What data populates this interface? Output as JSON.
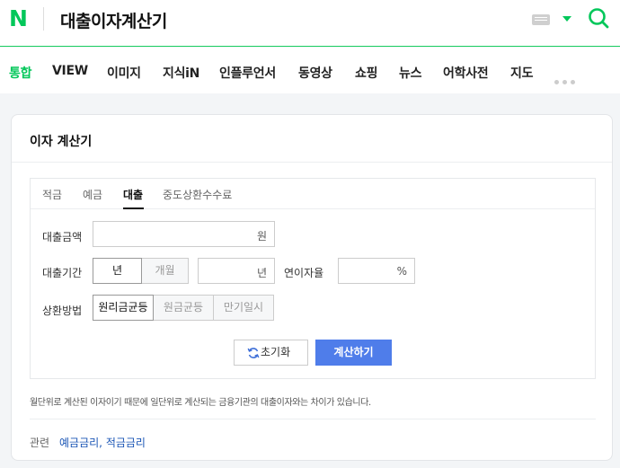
{
  "header": {
    "logo": "N",
    "query": "대출이자계산기",
    "keyboard_icon": "keyboard-icon",
    "search_icon": "search-icon",
    "accent": "#03c75a"
  },
  "nav": {
    "items": [
      "통합",
      "VIEW",
      "이미지",
      "지식iN",
      "인플루언서",
      "동영상",
      "쇼핑",
      "뉴스",
      "어학사전",
      "지도"
    ],
    "active_index": 0
  },
  "calculator": {
    "title": "이자 계산기",
    "tabs": [
      "적금",
      "예금",
      "대출",
      "중도상환수수료"
    ],
    "active_tab": "대출",
    "loan_amount": {
      "label": "대출금액",
      "value": "",
      "unit": "원"
    },
    "loan_term": {
      "label": "대출기간",
      "options": [
        "년",
        "개월"
      ],
      "selected": "년",
      "value": "",
      "unit": "년"
    },
    "rate": {
      "label": "연이자율",
      "value": "",
      "unit": "%"
    },
    "repayment": {
      "label": "상환방법",
      "options": [
        "원리금균등",
        "원금균등",
        "만기일시"
      ],
      "selected": "원리금균등"
    },
    "reset_label": "초기화",
    "calc_label": "계산하기",
    "primary_color": "#4f7dea"
  },
  "notice": "월단위로 계산된 이자이기 때문에 일단위로 계산되는 금융기관의 대출이자와는 차이가 있습니다.",
  "related": {
    "label": "관련",
    "links": [
      "예금금리",
      "적금금리"
    ],
    "separator": ", "
  }
}
